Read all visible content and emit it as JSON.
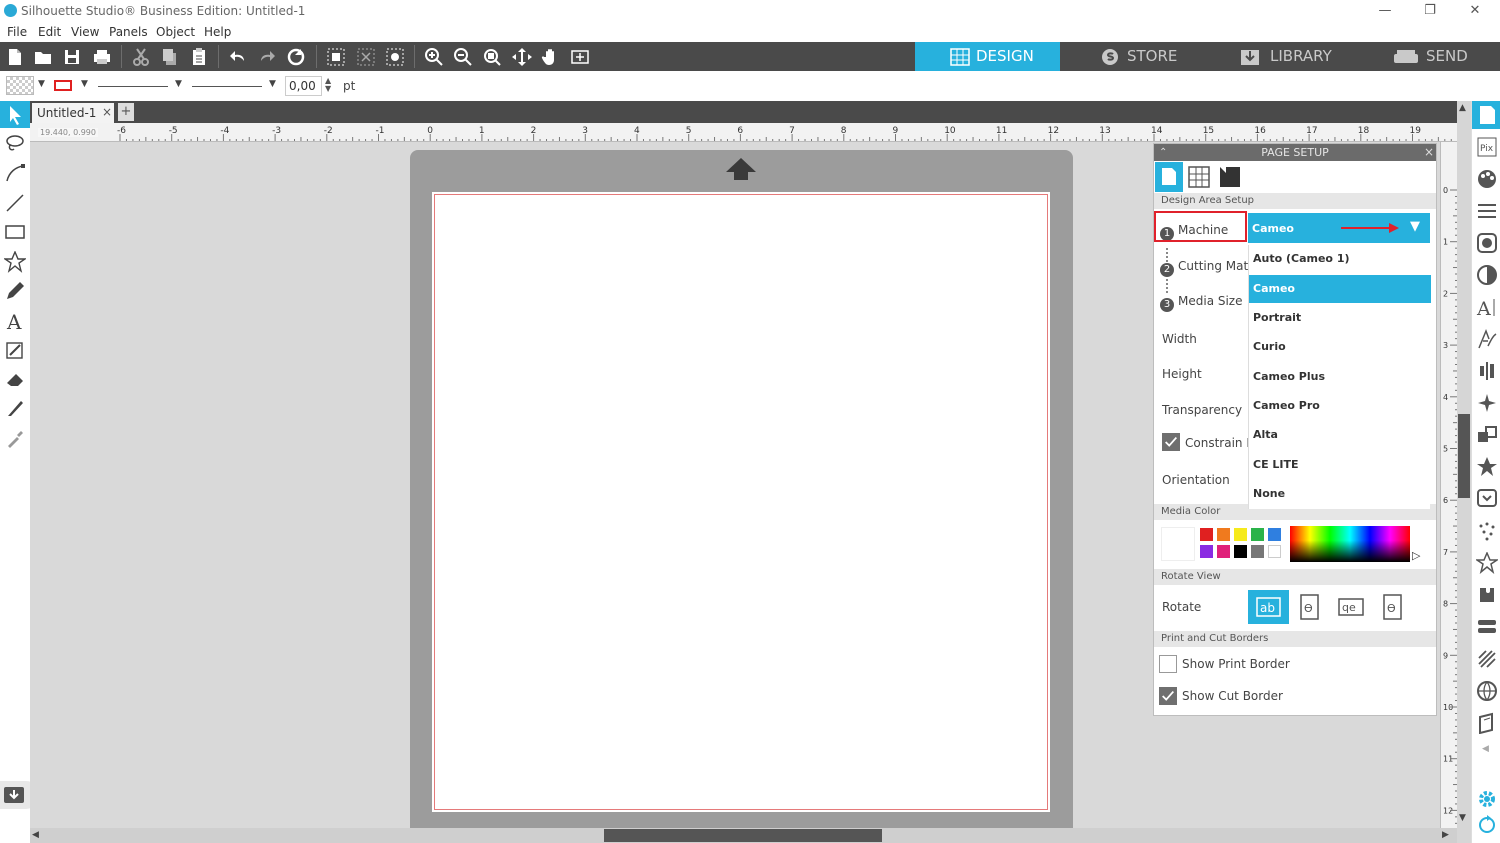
{
  "window": {
    "title": "Silhouette Studio® Business Edition: Untitled-1",
    "minimize": "—",
    "maximize": "❐",
    "close": "✕"
  },
  "menu": [
    "File",
    "Edit",
    "View",
    "Panels",
    "Object",
    "Help"
  ],
  "nav_tabs": [
    {
      "label": "DESIGN",
      "active": true
    },
    {
      "label": "STORE",
      "active": false
    },
    {
      "label": "LIBRARY",
      "active": false
    },
    {
      "label": "SEND",
      "active": false
    }
  ],
  "line_toolbar": {
    "line_width_value": "0,00",
    "unit": "pt"
  },
  "document": {
    "tab_label": "Untitled-1",
    "close": "×",
    "add": "+",
    "cursor_readout": "19.440, 0.990"
  },
  "ruler": {
    "h_ticks": [
      "-6",
      "-5",
      "-4",
      "-3",
      "-2",
      "-1",
      "0",
      "1",
      "2",
      "3",
      "4",
      "5",
      "6",
      "7",
      "8",
      "9",
      "10",
      "11",
      "12",
      "13",
      "14",
      "15",
      "16",
      "17",
      "18",
      "19"
    ],
    "v_ticks": [
      "0",
      "1",
      "2",
      "3",
      "4",
      "5",
      "6",
      "7",
      "8",
      "9",
      "10",
      "11",
      "12"
    ]
  },
  "page_setup": {
    "title": "PAGE SETUP",
    "close": "×",
    "sections": {
      "design_area": "Design Area Setup",
      "media_color": "Media Color",
      "rotate_view": "Rotate View",
      "print_cut_borders": "Print and Cut Borders"
    },
    "machine": {
      "num": "1",
      "label": "Machine",
      "value": "Cameo"
    },
    "cutting_mat": {
      "num": "2",
      "label": "Cutting Mat"
    },
    "media_size": {
      "num": "3",
      "label": "Media Size"
    },
    "width_label": "Width",
    "height_label": "Height",
    "transparency_label": "Transparency",
    "constrain_label": "Constrain M",
    "orientation_label": "Orientation",
    "rotate_label": "Rotate",
    "show_print_border": {
      "label": "Show Print Border",
      "checked": false
    },
    "show_cut_border": {
      "label": "Show Cut Border",
      "checked": true
    },
    "machine_options": [
      "Auto (Cameo 1)",
      "Cameo",
      "Portrait",
      "Curio",
      "Cameo Plus",
      "Cameo Pro",
      "Alta",
      "CE LITE",
      "None"
    ],
    "selected_option": "Cameo",
    "media_colors": [
      "#e02020",
      "#f07a1e",
      "#f6ea1c",
      "#2bb34a",
      "#2f7fe0",
      "#8a2be2",
      "#e0217a",
      "#000000",
      "#777777",
      "#ffffff"
    ]
  },
  "colors": {
    "accent": "#27b1dd",
    "toolbar": "#4a4a4a",
    "highlight": "#e0212b"
  }
}
